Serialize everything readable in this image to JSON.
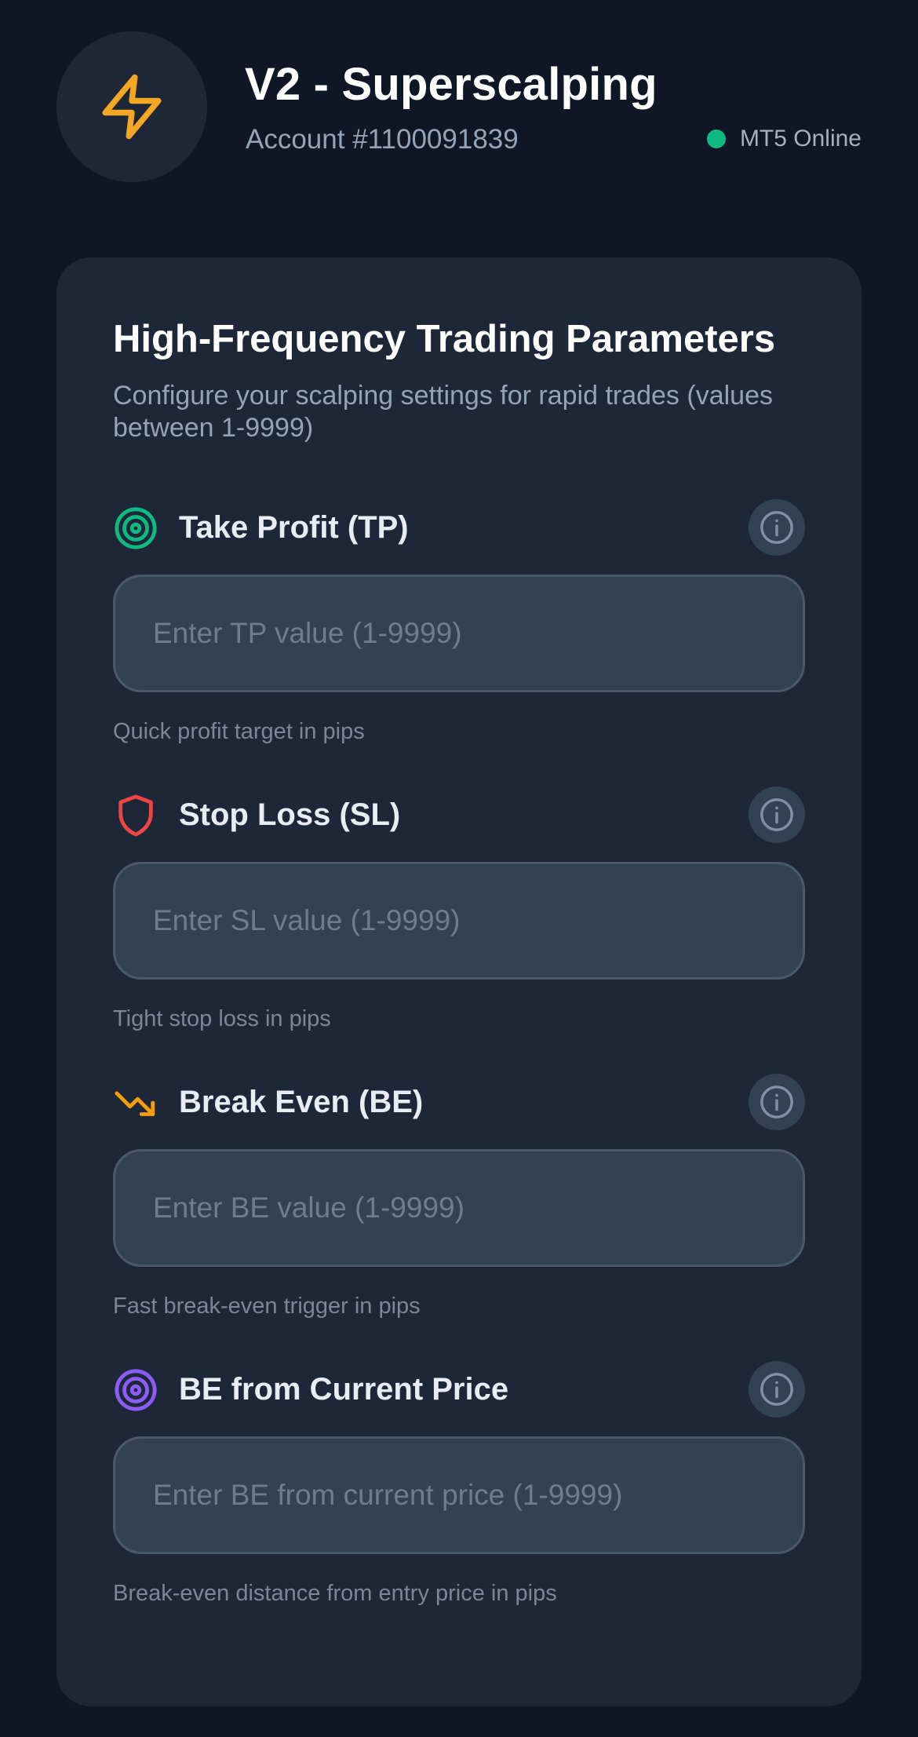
{
  "header": {
    "title": "V2 - Superscalping",
    "account": "Account #1100091839",
    "status_text": "MT5 Online",
    "logo_icon": "lightning-bolt-icon"
  },
  "card": {
    "title": "High-Frequency Trading Parameters",
    "subtitle": "Configure your scalping settings for rapid trades (values between 1-9999)"
  },
  "fields": [
    {
      "icon": "target-icon",
      "label": "Take Profit (TP)",
      "placeholder": "Enter TP value (1-9999)",
      "value": "",
      "help": "Quick profit target in pips"
    },
    {
      "icon": "shield-icon",
      "label": "Stop Loss (SL)",
      "placeholder": "Enter SL value (1-9999)",
      "value": "",
      "help": "Tight stop loss in pips"
    },
    {
      "icon": "trending-down-icon",
      "label": "Break Even (BE)",
      "placeholder": "Enter BE value (1-9999)",
      "value": "",
      "help": "Fast break-even trigger in pips"
    },
    {
      "icon": "radar-target-icon",
      "label": "BE from Current Price",
      "placeholder": "Enter BE from current price (1-9999)",
      "value": "",
      "help": "Break-even distance from entry price in pips"
    }
  ],
  "colors": {
    "background": "#0f1626",
    "card": "#1e2737",
    "input": "#334155",
    "status_online": "#10b981",
    "logo_accent": "#f5a623",
    "tp_icon": "#10b981",
    "sl_icon": "#ef4444",
    "be_icon": "#f59e0b",
    "be_current_icon": "#8b5cf6"
  }
}
